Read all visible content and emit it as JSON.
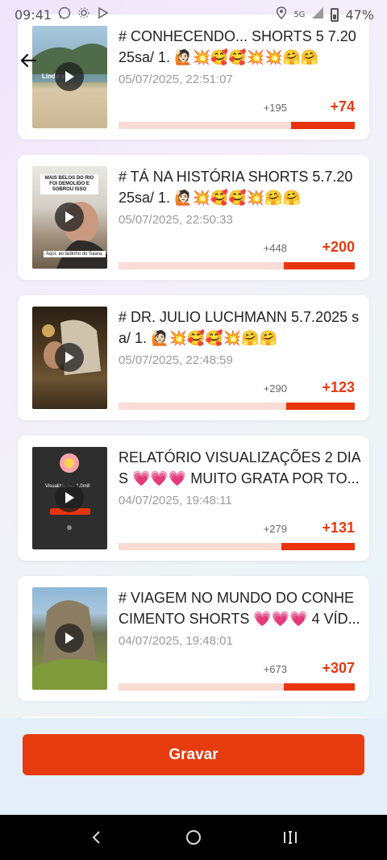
{
  "status_bar": {
    "time": "09:41",
    "network": "5G",
    "battery": "47%",
    "left_icons": [
      "whatsapp-icon",
      "settings-icon",
      "play-store-icon"
    ],
    "right_icons": [
      "location-icon",
      "signal-icon",
      "battery-icon"
    ]
  },
  "colors": {
    "accent": "#e53a12",
    "bar_bg": "#f9dcd5",
    "bar_fill": "#e8340c",
    "button": "#e63b0e"
  },
  "videos": [
    {
      "title": "# CONHECENDO... SHORTS 5 7.20 25sa/ 1. 🙋🏻💥🥰🥰💥💥🤗🤗",
      "date": "05/07/2025, 22:51:07",
      "delta_small": "+195",
      "delta_big": "+74",
      "progress": 0.27,
      "thumb_caption": "Lindo  s "
    },
    {
      "title": "# TÁ NA HISTÓRIA SHORTS 5.7.20 25sa/ 1. 🙋🏻💥🥰🥰💥🤗🤗",
      "date": "05/07/2025, 22:50:33",
      "delta_small": "+448",
      "delta_big": "+200",
      "progress": 0.3,
      "thumb_caption": "Aqui, ao ladinho do Saara,",
      "thumb_text": "MAIS BELOS DO RIO FOI DEMOLIDO E SOBROU ISSO"
    },
    {
      "title": "# DR. JULIO LUCHMANN 5.7.2025 sa/ 1. 🙋🏻💥🥰🥰💥🤗🤗",
      "date": "05/07/2025, 22:48:59",
      "delta_small": "+290",
      "delta_big": "+123",
      "progress": 0.29
    },
    {
      "title": "RELATÓRIO VISUALIZAÇÕES 2 DIA S 💗💗💗 MUITO GRATA POR TO...",
      "date": "04/07/2025, 19:48:11",
      "delta_small": "+279",
      "delta_big": "+131",
      "progress": 0.31,
      "thumb_text": "Visualizações 1,0mil!"
    },
    {
      "title": "# VIAGEM NO MUNDO DO CONHE CIMENTO SHORTS 💗💗💗 4 VÍD...",
      "date": "04/07/2025, 19:48:01",
      "delta_small": "+673",
      "delta_big": "+307",
      "progress": 0.3
    }
  ],
  "footer": {
    "record_label": "Gravar"
  },
  "nav": {
    "icons": [
      "back-icon",
      "home-icon",
      "recents-icon"
    ]
  }
}
